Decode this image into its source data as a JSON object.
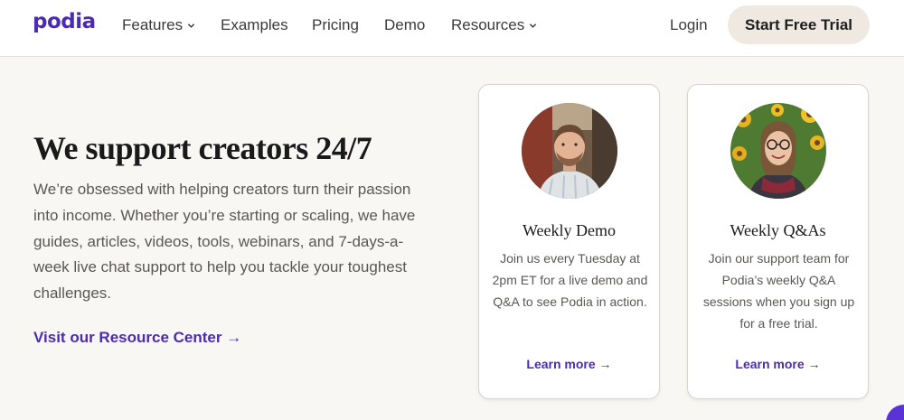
{
  "nav": {
    "logo": "podia",
    "items": [
      {
        "label": "Features",
        "dropdown": true
      },
      {
        "label": "Examples",
        "dropdown": false
      },
      {
        "label": "Pricing",
        "dropdown": false
      },
      {
        "label": "Demo",
        "dropdown": false
      },
      {
        "label": "Resources",
        "dropdown": true
      }
    ],
    "login": "Login",
    "cta": "Start Free Trial"
  },
  "hero": {
    "title": "We support creators 24/7",
    "text": "We’re obsessed with helping creators turn their passion into income. Whether you’re starting or scaling, we have guides, articles, videos, tools, webinars, and 7-days-a-week live chat support to help you tackle your toughest challenges.",
    "link": "Visit our Resource Center →"
  },
  "cards": [
    {
      "title": "Weekly Demo",
      "text": "Join us every Tuesday at 2pm ET for a live demo and Q&A to see Podia in action.",
      "link": "Learn more →"
    },
    {
      "title": "Weekly Q&As",
      "text": "Join our support team for Podia’s weekly Q&A sessions when you sign up for a free trial.",
      "link": "Learn more →"
    }
  ],
  "colors": {
    "brand": "#4b2bb1",
    "background": "#f9f7f4",
    "cta_bg": "#efe9e2"
  }
}
